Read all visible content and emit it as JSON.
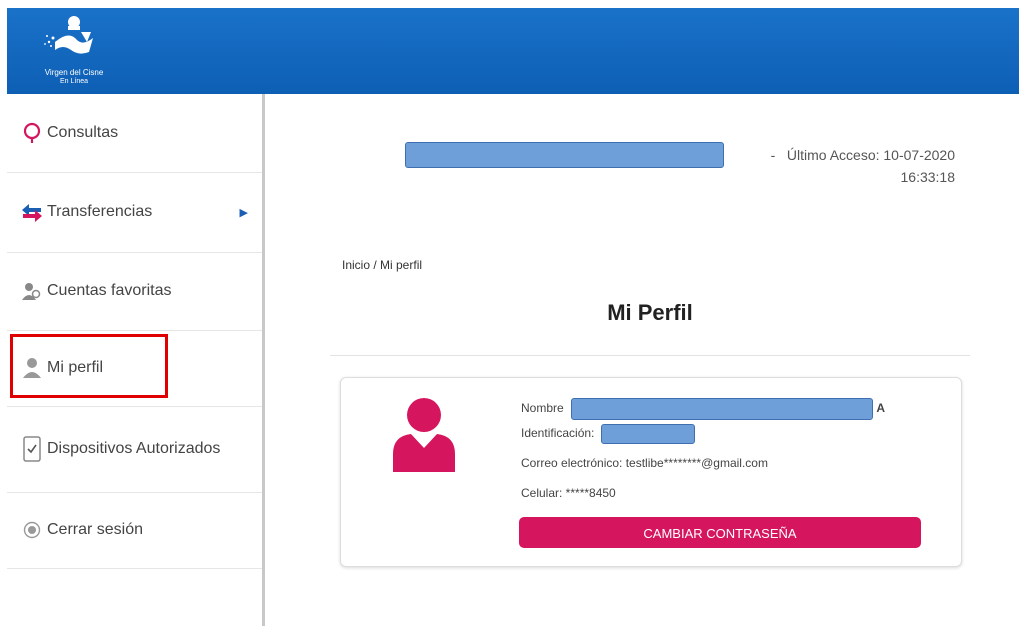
{
  "brand": {
    "name": "Virgen del Cisne",
    "subtitle": "En Línea",
    "colors": {
      "header": "#0d5fb4",
      "accent": "#d6155f"
    }
  },
  "sidebar": {
    "items": [
      {
        "label": "Consultas",
        "icon": "search-icon"
      },
      {
        "label": "Transferencias",
        "icon": "transfer-icon",
        "caret": "▶"
      },
      {
        "label": "Cuentas favoritas",
        "icon": "users-icon"
      },
      {
        "label": "Mi perfil",
        "icon": "user-icon"
      },
      {
        "label": "Dispositivos Autorizados",
        "icon": "device-check-icon"
      },
      {
        "label": "Cerrar sesión",
        "icon": "power-icon"
      }
    ]
  },
  "access": {
    "separator": "-",
    "line1": "Último Acceso: 10-07-2020",
    "line2": "16:33:18"
  },
  "breadcrumb": "Inicio / Mi perfil",
  "page_title": "Mi Perfil",
  "profile": {
    "name_label": "Nombre",
    "name_suffix": "A",
    "id_label": "Identificación:",
    "email": "Correo electrónico: testlibe********@gmail.com",
    "phone": "Celular: *****8450",
    "change_password_label": "CAMBIAR CONTRASEÑA"
  }
}
